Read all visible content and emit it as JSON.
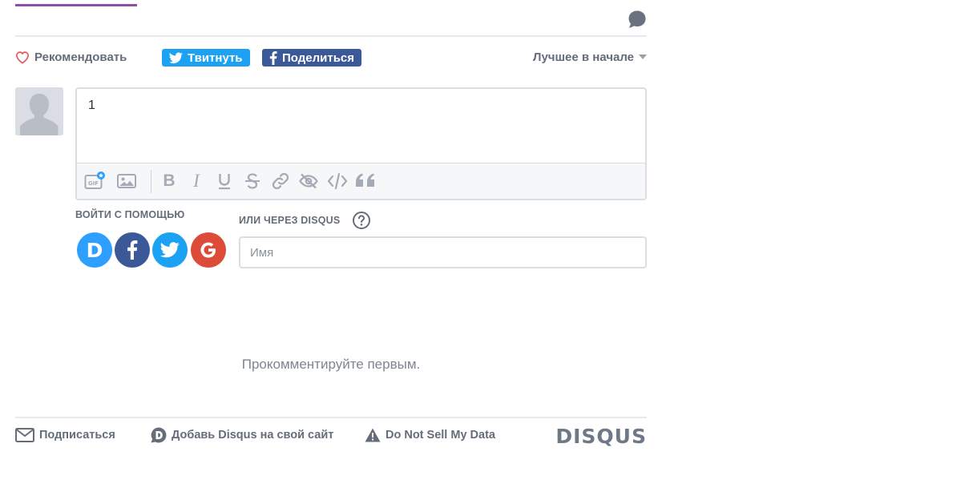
{
  "action_bar": {
    "recommend_label": "Рекомендовать",
    "tweet_label": "Твитнуть",
    "share_label": "Поделиться",
    "sort_label": "Лучшее в начале"
  },
  "composer": {
    "text": "1",
    "toolbar_icons": [
      "gif-icon",
      "image-icon",
      "bold-icon",
      "italic-icon",
      "underline-icon",
      "strikethrough-icon",
      "link-icon",
      "spoiler-icon",
      "code-icon",
      "quote-icon"
    ]
  },
  "login": {
    "social_label": "ВОЙТИ С ПОМОЩЬЮ",
    "disqus_label": "ИЛИ ЧЕРЕЗ DISQUS",
    "services": [
      "disqus",
      "facebook",
      "twitter",
      "google"
    ],
    "name_placeholder": "Имя"
  },
  "empty_state": "Прокомментируйте первым.",
  "footer": {
    "subscribe_label": "Подписаться",
    "add_disqus_label": "Добавь Disqus на свой сайт",
    "do_not_sell_label": "Do Not Sell My Data",
    "logo_text": "DISQUS"
  },
  "colors": {
    "accent_purple": "#8e4ba8",
    "twitter": "#1da1f2",
    "facebook": "#3b5998",
    "disqus_blue": "#2e9fff",
    "google": "#dd4b39",
    "heart": "#e8565c"
  }
}
